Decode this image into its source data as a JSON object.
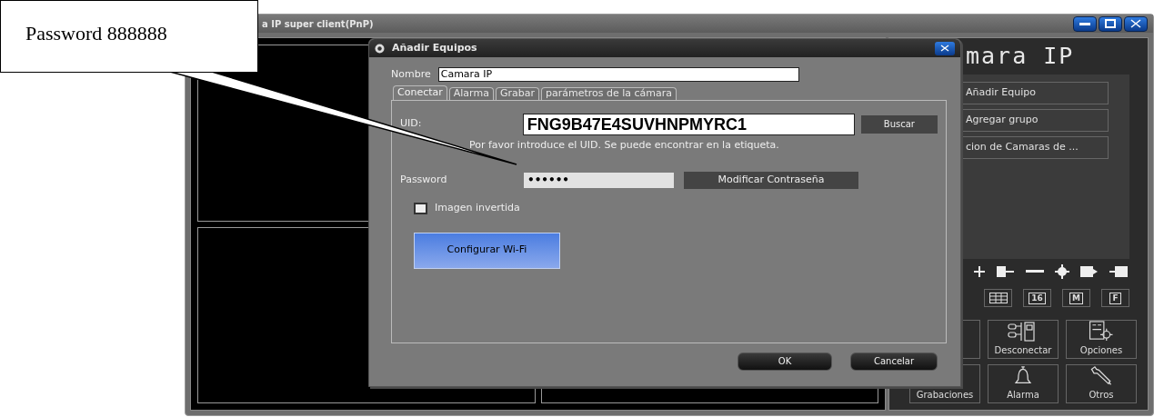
{
  "annotation": {
    "text": "Password 888888"
  },
  "window": {
    "title": "a IP super client(PnP)"
  },
  "dialog": {
    "title": "Añadir Equipos",
    "name_label": "Nombre",
    "name_value": "Camara IP",
    "tabs": [
      {
        "label": "Conectar",
        "selected": true
      },
      {
        "label": "Alarma",
        "selected": false
      },
      {
        "label": "Grabar",
        "selected": false
      },
      {
        "label": "parámetros de la cámara",
        "selected": false
      }
    ],
    "uid_label": "UID:",
    "uid_value": "FNG9B47E4SUVHNPMYRC1",
    "search_button": "Buscar",
    "hint": "Por favor introduce el UID. Se puede encontrar en la etiqueta.",
    "password_label": "Password",
    "password_value": "••••••",
    "change_password_button": "Modificar Contraseña",
    "invert_image": {
      "label": "Imagen invertida",
      "checked": false
    },
    "wifi_button": "Configurar Wi-Fi",
    "ok_button": "OK",
    "cancel_button": "Cancelar"
  },
  "side_panel": {
    "title": "mara IP",
    "actions": [
      "Añadir Equipo",
      "Agregar grupo",
      "cion de Camaras de ..."
    ],
    "view_buttons": [
      {
        "kind": "grid"
      },
      {
        "kind": "label",
        "label": "16"
      },
      {
        "kind": "label",
        "label": "M"
      },
      {
        "kind": "label",
        "label": "F"
      }
    ],
    "tiles": [
      {
        "kind": "network",
        "label": "Desconectar"
      },
      {
        "kind": "options",
        "label": "Opciones"
      },
      {
        "kind": "recordings",
        "label": "Grabaciones"
      },
      {
        "kind": "alarm",
        "label": "Alarma"
      },
      {
        "kind": "tools",
        "label": "Otros"
      }
    ]
  }
}
